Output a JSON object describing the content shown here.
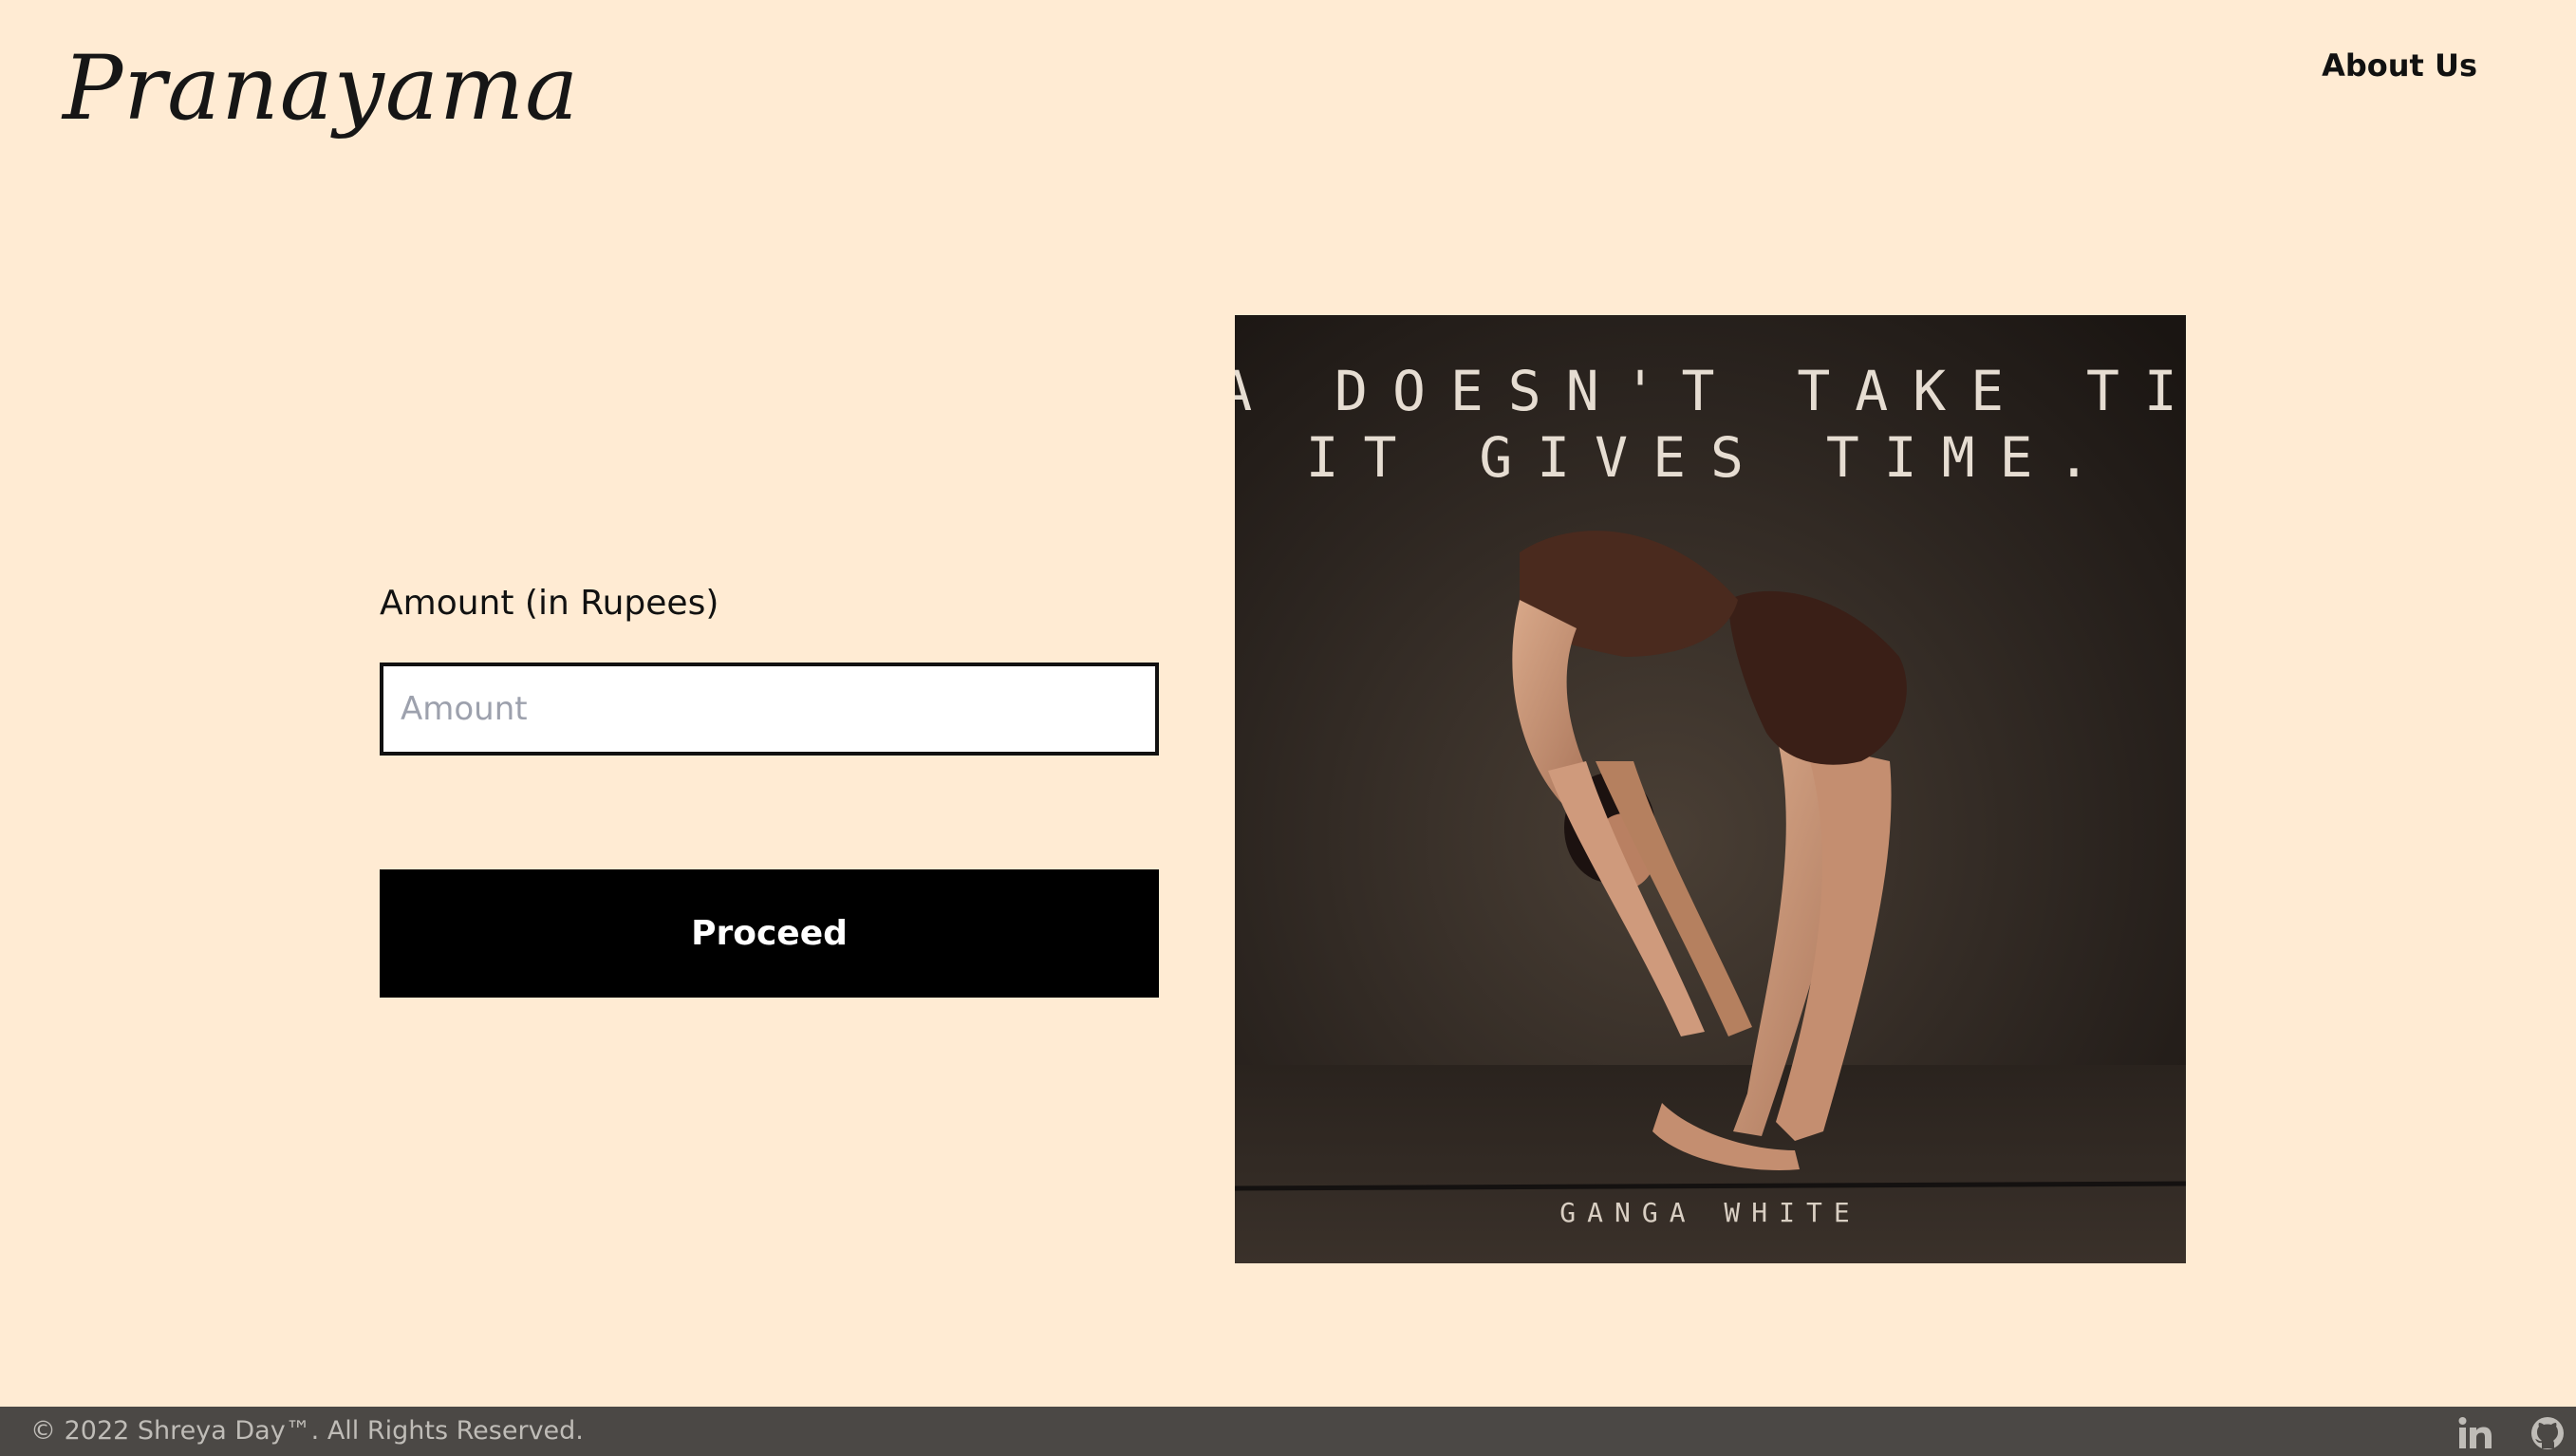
{
  "header": {
    "logo_text": "Pranayama",
    "nav": {
      "about_label": "About Us"
    }
  },
  "form": {
    "amount_label": "Amount (in Rupees)",
    "amount_placeholder": "Amount",
    "amount_value": "",
    "proceed_label": "Proceed"
  },
  "poster": {
    "quote_line_1": "YOGA DOESN'T TAKE TIME.",
    "quote_line_2": "IT GIVES TIME.",
    "author": "GANGA WHITE"
  },
  "footer": {
    "copyright": "© 2022 Shreya Day™. All Rights Reserved.",
    "social_icons": [
      "linkedin-icon",
      "github-icon"
    ]
  },
  "colors": {
    "page_background": "#ffebd3",
    "footer_background": "#4b4845",
    "button_background": "#000000",
    "button_text": "#ffffff"
  }
}
